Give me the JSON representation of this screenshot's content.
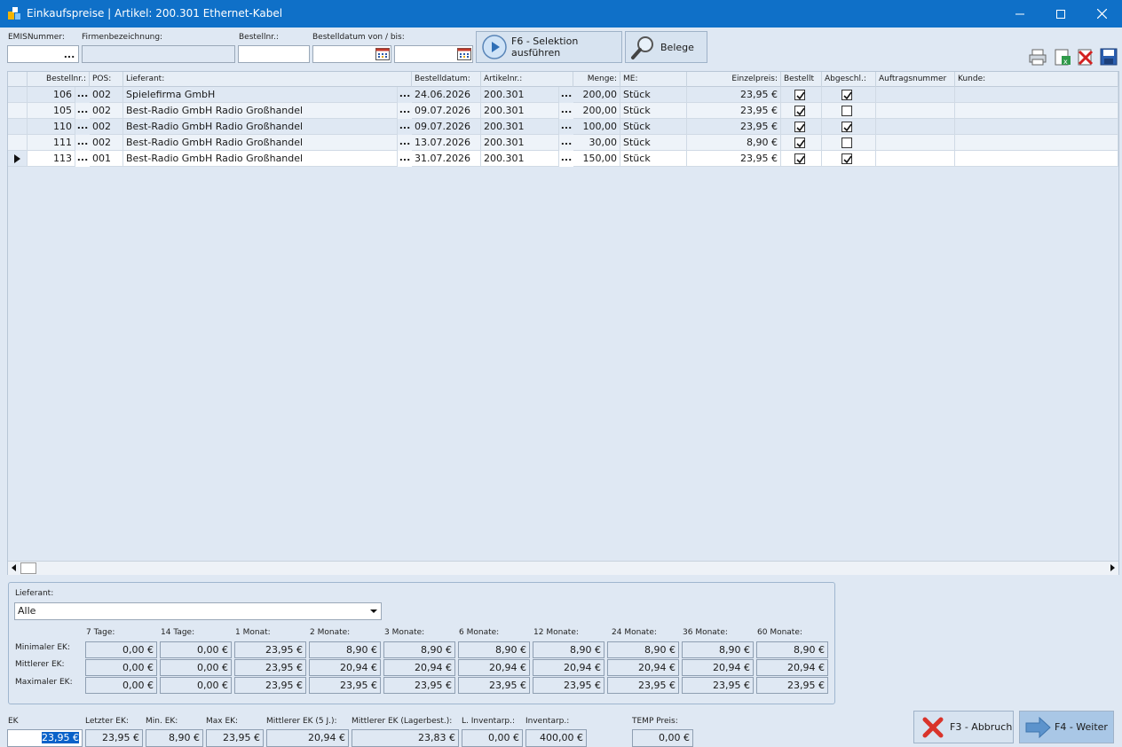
{
  "window": {
    "title": "Einkaufspreise | Artikel: 200.301 Ethernet-Kabel",
    "minimize": "—",
    "maximize": "☐",
    "close": "✕"
  },
  "filters": {
    "emis_label": "EMISNummer:",
    "firma_label": "Firmenbezeichnung:",
    "bestellnr_label": "Bestellnr.:",
    "datum_label": "Bestelldatum von / bis:",
    "ellipsis": "...",
    "selektion_line1": "F6 - Selektion",
    "selektion_line2": "ausführen",
    "belege_label": "Belege"
  },
  "grid": {
    "headers": {
      "bestellnr": "Bestellnr.:",
      "pos": "POS:",
      "lieferant": "Lieferant:",
      "bestelldatum": "Bestelldatum:",
      "artikelnr": "Artikelnr.:",
      "menge": "Menge:",
      "me": "ME:",
      "einzelpreis": "Einzelpreis:",
      "bestellt": "Bestellt",
      "abgeschl": "Abgeschl.:",
      "auftragsnummer": "Auftragsnummer",
      "kunde": "Kunde:"
    },
    "rows": [
      {
        "bestellnr": "106",
        "pos": "002",
        "lieferant": "Spielefirma GmbH",
        "datum": "24.06.2026",
        "artikel": "200.301",
        "menge": "200,00",
        "me": "Stück",
        "preis": "23,95 €",
        "bestellt": true,
        "abgeschl": true,
        "auftrag": "",
        "kunde": ""
      },
      {
        "bestellnr": "105",
        "pos": "002",
        "lieferant": "Best-Radio GmbH Radio Großhandel",
        "datum": "09.07.2026",
        "artikel": "200.301",
        "menge": "200,00",
        "me": "Stück",
        "preis": "23,95 €",
        "bestellt": true,
        "abgeschl": false,
        "auftrag": "",
        "kunde": ""
      },
      {
        "bestellnr": "110",
        "pos": "002",
        "lieferant": "Best-Radio GmbH Radio Großhandel",
        "datum": "09.07.2026",
        "artikel": "200.301",
        "menge": "100,00",
        "me": "Stück",
        "preis": "23,95 €",
        "bestellt": true,
        "abgeschl": true,
        "auftrag": "",
        "kunde": ""
      },
      {
        "bestellnr": "111",
        "pos": "002",
        "lieferant": "Best-Radio GmbH Radio Großhandel",
        "datum": "13.07.2026",
        "artikel": "200.301",
        "menge": "30,00",
        "me": "Stück",
        "preis": "8,90 €",
        "bestellt": true,
        "abgeschl": false,
        "auftrag": "",
        "kunde": ""
      },
      {
        "bestellnr": "113",
        "pos": "001",
        "lieferant": "Best-Radio GmbH Radio Großhandel",
        "datum": "31.07.2026",
        "artikel": "200.301",
        "menge": "150,00",
        "me": "Stück",
        "preis": "23,95 €",
        "bestellt": true,
        "abgeschl": true,
        "auftrag": "",
        "kunde": ""
      }
    ]
  },
  "stats": {
    "lieferant_label": "Lieferant:",
    "lieferant_value": "Alle",
    "periods": [
      "7 Tage:",
      "14 Tage:",
      "1 Monat:",
      "2 Monate:",
      "3 Monate:",
      "6 Monate:",
      "12 Monate:",
      "24 Monate:",
      "36 Monate:",
      "60 Monate:"
    ],
    "row_labels": [
      "Minimaler EK:",
      "Mittlerer EK:",
      "Maximaler EK:"
    ],
    "values": [
      [
        "0,00 €",
        "0,00 €",
        "23,95 €",
        "8,90 €",
        "8,90 €",
        "8,90 €",
        "8,90 €",
        "8,90 €",
        "8,90 €",
        "8,90 €"
      ],
      [
        "0,00 €",
        "0,00 €",
        "23,95 €",
        "20,94 €",
        "20,94 €",
        "20,94 €",
        "20,94 €",
        "20,94 €",
        "20,94 €",
        "20,94 €"
      ],
      [
        "0,00 €",
        "0,00 €",
        "23,95 €",
        "23,95 €",
        "23,95 €",
        "23,95 €",
        "23,95 €",
        "23,95 €",
        "23,95 €",
        "23,95 €"
      ]
    ]
  },
  "bottom": {
    "ek_label": "EK",
    "ek_value": "23,95 €",
    "letzter_label": "Letzter EK:",
    "letzter_value": "23,95 €",
    "min_label": "Min. EK:",
    "min_value": "8,90 €",
    "max_label": "Max EK:",
    "max_value": "23,95 €",
    "mittl5_label": "Mittlerer EK (5 J.):",
    "mittl5_value": "20,94 €",
    "mittllager_label": "Mittlerer EK (Lagerbest.):",
    "mittllager_value": "23,83 €",
    "linv_label": "L. Inventarp.:",
    "linv_value": "0,00 €",
    "inv_label": "Inventarp.:",
    "inv_value": "400,00 €",
    "temp_label": "TEMP Preis:",
    "temp_value": "0,00 €",
    "abbruch_label": "F3 - Abbruch",
    "weiter_label": "F4 - Weiter"
  }
}
